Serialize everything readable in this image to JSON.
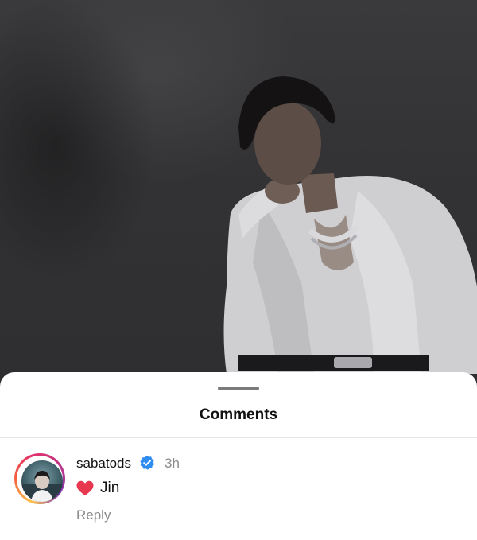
{
  "sheet": {
    "title": "Comments"
  },
  "comment": {
    "username": "sabatods",
    "verified_icon": "verified-badge-icon",
    "time": "3h",
    "emoji_icon": "red-heart-icon",
    "text": "Jin",
    "reply_label": "Reply"
  },
  "colors": {
    "verified": "#2f8cf0",
    "heart": "#e8384f",
    "secondary_text": "#8a8a8a"
  }
}
